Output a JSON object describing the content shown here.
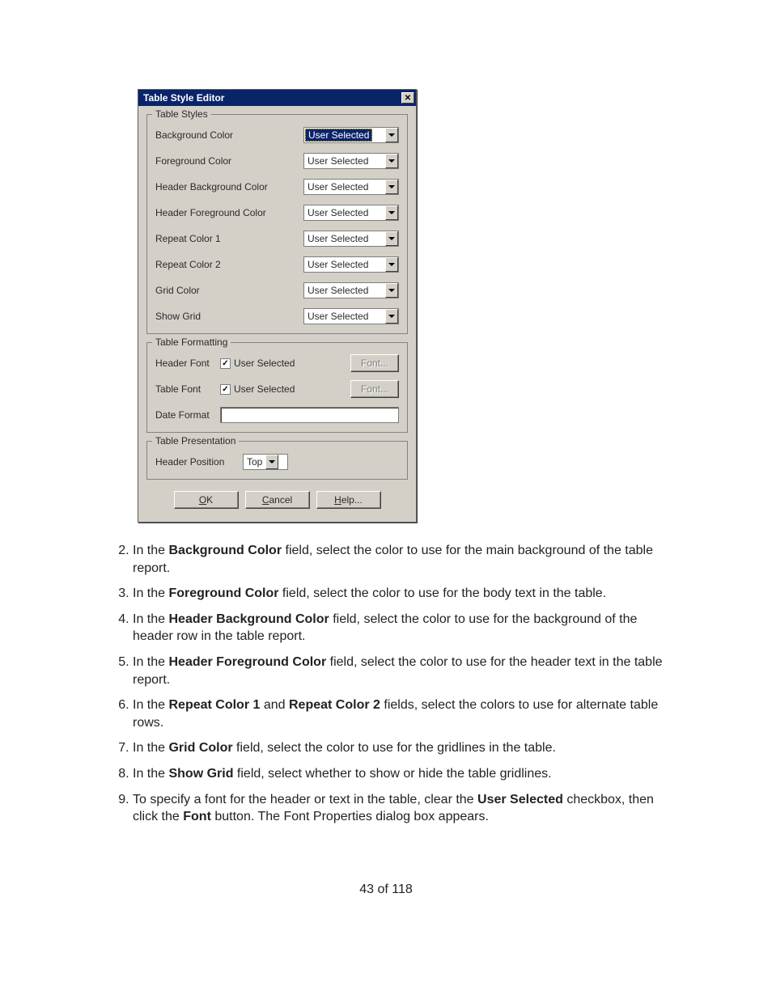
{
  "dialog": {
    "title": "Table Style Editor",
    "groups": {
      "styles": {
        "legend": "Table Styles",
        "rows": [
          {
            "label": "Background Color",
            "value": "User Selected",
            "selected": true
          },
          {
            "label": "Foreground Color",
            "value": "User Selected",
            "selected": false
          },
          {
            "label": "Header Background Color",
            "value": "User Selected",
            "selected": false
          },
          {
            "label": "Header Foreground Color",
            "value": "User Selected",
            "selected": false
          },
          {
            "label": "Repeat Color 1",
            "value": "User Selected",
            "selected": false
          },
          {
            "label": "Repeat Color 2",
            "value": "User Selected",
            "selected": false
          },
          {
            "label": "Grid Color",
            "value": "User Selected",
            "selected": false
          },
          {
            "label": "Show Grid",
            "value": "User Selected",
            "selected": false
          }
        ]
      },
      "formatting": {
        "legend": "Table Formatting",
        "header_font_label": "Header Font",
        "header_font_checked": true,
        "table_font_label": "Table Font",
        "table_font_checked": true,
        "user_selected_label": "User Selected",
        "font_button": "Font...",
        "date_format_label": "Date Format",
        "date_format_value": ""
      },
      "presentation": {
        "legend": "Table Presentation",
        "header_position_label": "Header Position",
        "header_position_value": "Top"
      }
    },
    "buttons": {
      "ok": "OK",
      "cancel": "Cancel",
      "help": "Help..."
    }
  },
  "instructions": {
    "start": 2,
    "items": [
      {
        "pre": "In the ",
        "b1": "Background Color",
        "mid": " field, select the color to use for the main background of the table report."
      },
      {
        "pre": "In the ",
        "b1": "Foreground Color",
        "mid": " field, select the color to use for the body text in the table."
      },
      {
        "pre": "In the ",
        "b1": "Header Background Color",
        "mid": " field, select the color to use for the background of the header row in the table report."
      },
      {
        "pre": "In the ",
        "b1": "Header Foreground Color",
        "mid": " field, select the color to use for the header text in the table report."
      },
      {
        "pre": "In the ",
        "b1": "Repeat Color 1",
        "mid": " and ",
        "b2": "Repeat Color 2",
        "post": " fields, select the colors to use for alternate table rows."
      },
      {
        "pre": "In the ",
        "b1": "Grid Color",
        "mid": " field, select the color to use for the gridlines in the table."
      },
      {
        "pre": "In the ",
        "b1": "Show Grid",
        "mid": " field, select whether to show or hide the table gridlines."
      },
      {
        "pre": "To specify a font for the header or text in the table, clear the ",
        "b1": "User Selected",
        "mid": " checkbox, then click the ",
        "b2": "Font",
        "post": " button. The Font Properties dialog box appears."
      }
    ]
  },
  "footer": "43 of 118"
}
